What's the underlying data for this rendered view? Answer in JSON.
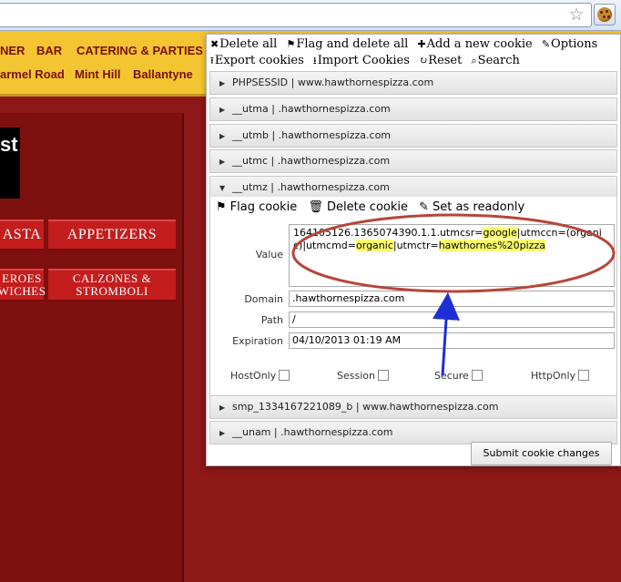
{
  "browser": {
    "star_icon": "star-icon",
    "extension_icon": "cookie-icon"
  },
  "site": {
    "nav_row1": [
      "NER",
      "BAR",
      "CATERING & PARTIES"
    ],
    "nav_row2": [
      "armel Road",
      "Mint Hill",
      "Ballantyne"
    ],
    "banner_text": "st",
    "ribbons": [
      "ASTA",
      "APPETIZERS",
      "EROES WICHES",
      "CALZONES & STROMBOLI"
    ]
  },
  "popup": {
    "toolbar_row1": [
      {
        "icon": "✖",
        "label": "Delete all"
      },
      {
        "icon": "⚑",
        "label": "Flag and delete all"
      },
      {
        "icon": "✚",
        "label": "Add a new cookie"
      },
      {
        "icon": "✎",
        "label": "Options"
      }
    ],
    "toolbar_row2": [
      {
        "icon": "⭱",
        "label": "Export cookies"
      },
      {
        "icon": "⭳",
        "label": "Import Cookies"
      },
      {
        "icon": "↻",
        "label": "Reset"
      },
      {
        "icon": "⌕",
        "label": "Search"
      }
    ],
    "cookies_above": [
      "PHPSESSID | www.hawthornespizza.com",
      "__utma | .hawthornespizza.com",
      "__utmb | .hawthornespizza.com",
      "__utmc | .hawthornespizza.com"
    ],
    "expanded_cookie": "__utmz | .hawthornespizza.com",
    "detail": {
      "flag_label": "Flag cookie",
      "delete_label": "Delete cookie",
      "readonly_label": "Set as readonly",
      "value_label": "Value",
      "value_parts": [
        {
          "text": "164105126.1365074390.1.1.utmcsr=",
          "hl": false
        },
        {
          "text": "google",
          "hl": true
        },
        {
          "text": "|utmccn=(organic)|utmcmd=",
          "hl": false
        },
        {
          "text": "organic",
          "hl": true
        },
        {
          "text": "|utmctr=",
          "hl": false
        },
        {
          "text": "hawthornes%20pizza",
          "hl": true
        }
      ],
      "domain_label": "Domain",
      "domain_value": ".hawthornespizza.com",
      "path_label": "Path",
      "path_value": "/",
      "expiration_label": "Expiration",
      "expiration_value": "04/10/2013 01:19 AM",
      "checkboxes": [
        {
          "label": "HostOnly",
          "checked": false
        },
        {
          "label": "Session",
          "checked": false
        },
        {
          "label": "Secure",
          "checked": false
        },
        {
          "label": "HttpOnly",
          "checked": false
        }
      ]
    },
    "cookies_below": [
      "smp_1334167221089_b | www.hawthornespizza.com",
      "__unam | .hawthornespizza.com"
    ],
    "submit_label": "Submit cookie changes"
  },
  "annotation_colors": {
    "ellipse": "#b5463a",
    "arrow": "#1f2fd6"
  }
}
